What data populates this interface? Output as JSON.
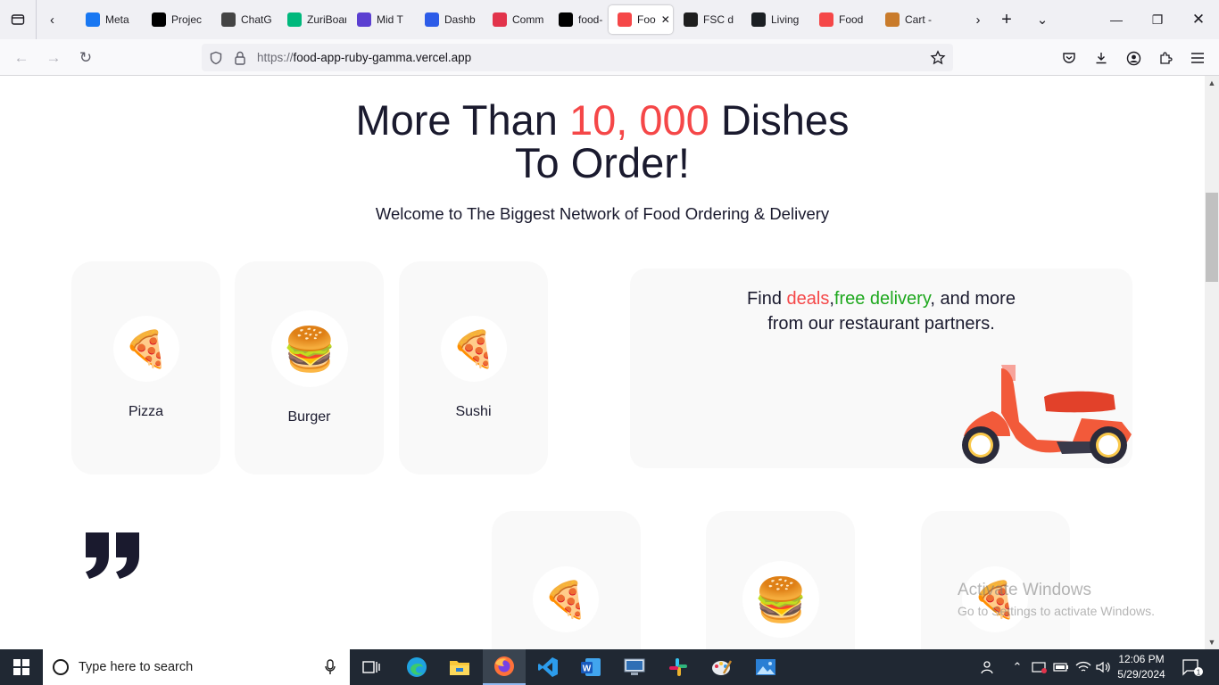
{
  "browser": {
    "tabs": [
      {
        "label": "Meta",
        "icon": "meta-icon",
        "color": "#1877f2"
      },
      {
        "label": "Projec",
        "icon": "alx-icon",
        "color": "#000000"
      },
      {
        "label": "ChatG",
        "icon": "chatgpt-icon",
        "color": "#444444"
      },
      {
        "label": "ZuriBoard",
        "icon": "zuriboard-icon",
        "color": "#00b87c"
      },
      {
        "label": "Mid T",
        "icon": "midterm-icon",
        "color": "#5b3fd1"
      },
      {
        "label": "Dashb",
        "icon": "dashboard-icon",
        "color": "#2d5ce8"
      },
      {
        "label": "Comm",
        "icon": "community-icon",
        "color": "#e2334b"
      },
      {
        "label": "food-",
        "icon": "vercel-icon",
        "color": "#000000"
      },
      {
        "label": "Foo",
        "icon": "pizza-icon",
        "color": "#f54748",
        "active": true
      },
      {
        "label": "FSC d",
        "icon": "figma-icon",
        "color": "#1e1e1e"
      },
      {
        "label": "Living",
        "icon": "github-icon",
        "color": "#1b1f23"
      },
      {
        "label": "Food",
        "icon": "pizza-icon",
        "color": "#f54748"
      },
      {
        "label": "Cart -",
        "icon": "cart-icon",
        "color": "#c97b2b"
      }
    ],
    "url_prefix": "https://",
    "url_host": "food-app-ruby-gamma.vercel.app"
  },
  "page": {
    "hero_title_before": "More Than ",
    "hero_title_accent": "10, 000",
    "hero_title_after": " Dishes",
    "hero_title_line2": "To Order!",
    "hero_subtitle": "Welcome to The Biggest Network of Food Ordering & Delivery",
    "categories": [
      {
        "label": "Pizza",
        "emoji": "🍕"
      },
      {
        "label": "Burger",
        "emoji": "🍔"
      },
      {
        "label": "Sushi",
        "emoji": "🍕"
      }
    ],
    "deal": {
      "before": "Find ",
      "red": "deals",
      "comma": ",",
      "green": "free delivery",
      "after": ", and more",
      "line2": "from our restaurant partners."
    },
    "lower_cards": [
      {
        "emoji": "🍕"
      },
      {
        "emoji": "🍔"
      },
      {
        "emoji": "🍕"
      }
    ],
    "accent_color": "#f54748"
  },
  "watermark": {
    "title": "Activate Windows",
    "subtitle": "Go to Settings to activate Windows."
  },
  "taskbar": {
    "search_placeholder": "Type here to search",
    "time": "12:06 PM",
    "date": "5/29/2024",
    "notification_count": "1"
  }
}
